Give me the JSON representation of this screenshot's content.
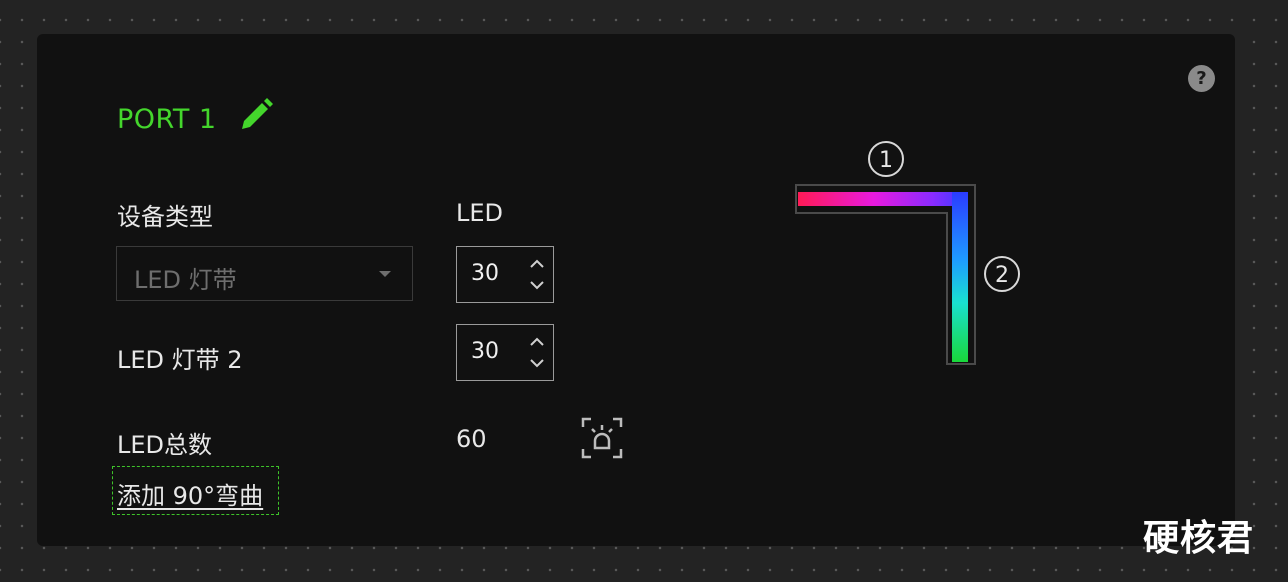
{
  "panel": {
    "port_title": "PORT 1",
    "device_type_label": "设备类型",
    "led_header": "LED",
    "device_type_value": "LED 灯带",
    "strip2_label": "LED 灯带 2",
    "led_count_1": "30",
    "led_count_2": "30",
    "led_total_label": "LED总数",
    "led_total_value": "60",
    "add_bend_label": "添加 90°弯曲",
    "help_icon_glyph": "?"
  },
  "diagram": {
    "segment_labels": [
      "1",
      "2"
    ],
    "strip_colors_segment1": [
      "#ff1a55",
      "#e81adf",
      "#8a2bff",
      "#3a3aff"
    ],
    "strip_colors_segment2": [
      "#2b3bff",
      "#1e9bff",
      "#19e0d0",
      "#19d83a"
    ]
  },
  "watermark": "硬核君",
  "colors": {
    "accent": "#44d62c",
    "panel_bg": "#111111",
    "page_bg": "#232323"
  },
  "icons": {
    "edit": "pencil-icon",
    "help": "help-icon",
    "led_locate": "led-locate-icon",
    "dropdown": "chevron-down-icon",
    "stepper_up": "chevron-up-icon",
    "stepper_down": "chevron-down-icon"
  }
}
